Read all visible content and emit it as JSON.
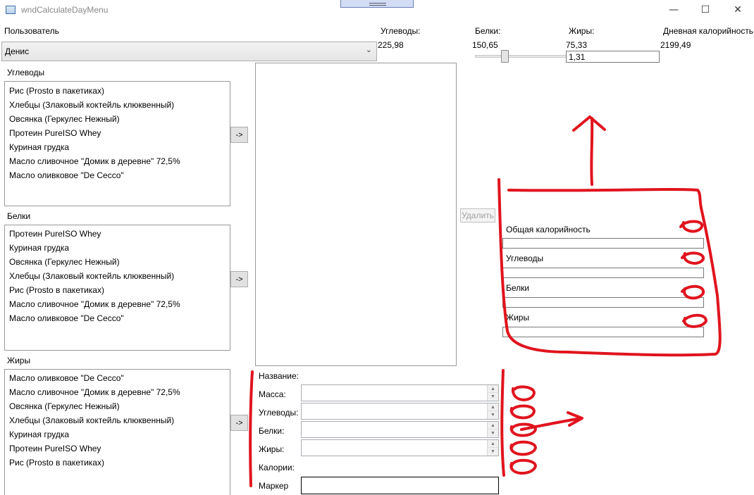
{
  "window": {
    "title": "wndCalculateDayMenu",
    "controls": [
      "—",
      "☐",
      "✕"
    ]
  },
  "header": {
    "user_label": "Пользователь",
    "user_value": "Денис",
    "carbs_label": "Углеводы:",
    "carbs_value": "225,98",
    "protein_label": "Белки:",
    "protein_value": "150,65",
    "fat_label": "Жиры:",
    "fat_value": "75,33",
    "calories_label": "Дневная калорийность",
    "calories_value": "2199,49",
    "slider_value": "1,31",
    "slider_level": 0.15
  },
  "lists": {
    "carbs": {
      "label": "Углеводы",
      "items": [
        "Рис (Prosto в пакетиках)",
        "Хлебцы (Злаковый коктейль клюквенный)",
        "Овсянка (Геркулес Нежный)",
        "Протеин PureISO Whey",
        "Куриная грудка",
        "Масло сливочное \"Домик в деревне\" 72,5%",
        "Масло оливковое \"De Cecco\""
      ]
    },
    "protein": {
      "label": "Белки",
      "items": [
        "Протеин PureISO Whey",
        "Куриная грудка",
        "Овсянка (Геркулес Нежный)",
        "Хлебцы (Злаковый коктейль клюквенный)",
        "Рис (Prosto в пакетиках)",
        "Масло сливочное \"Домик в деревне\" 72,5%",
        "Масло оливковое \"De Cecco\""
      ]
    },
    "fat": {
      "label": "Жиры",
      "items": [
        "Масло оливковое \"De Cecco\"",
        "Масло сливочное \"Домик в деревне\" 72,5%",
        "Овсянка (Геркулес Нежный)",
        "Хлебцы (Злаковый коктейль клюквенный)",
        "Куриная грудка",
        "Протеин PureISO Whey",
        "Рис (Prosto в пакетиках)"
      ]
    },
    "add_button_label": "->"
  },
  "delete_button_label": "Удалить",
  "summary": {
    "total_calories_label": "Общая калорийность",
    "carbs_label": "Углеводы",
    "protein_label": "Белки",
    "fat_label": "Жиры"
  },
  "form": {
    "name_label": "Название:",
    "mass_label": "Масса:",
    "carbs_label": "Углеводы:",
    "protein_label": "Белки:",
    "fat_label": "Жиры:",
    "calories_label": "Калории:",
    "marker_label": "Маркер"
  },
  "colors": {
    "annotation": "#e0141e",
    "slider_thumb": "#e4e4e4"
  }
}
